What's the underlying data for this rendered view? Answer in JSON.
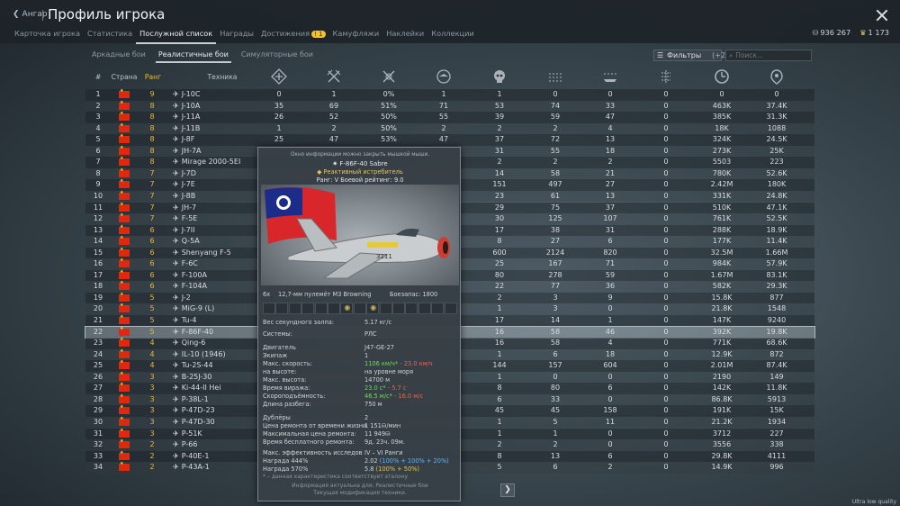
{
  "header": {
    "back_label": "Ангар",
    "title": "Профиль игрока",
    "tabs": [
      {
        "label": "Карточка игрока"
      },
      {
        "label": "Статистика"
      },
      {
        "label": "Послужной список"
      },
      {
        "label": "Награды"
      },
      {
        "label": "Достижения"
      },
      {
        "label": "Камуфляжи"
      },
      {
        "label": "Наклейки"
      },
      {
        "label": "Коллекции"
      }
    ],
    "achievements_badge": "! 1",
    "silver": "936 267",
    "gold": "1 173"
  },
  "subtabs": [
    {
      "label": "Аркадные бои"
    },
    {
      "label": "Реалистичные бои"
    },
    {
      "label": "Симуляторные бои"
    }
  ],
  "filter": {
    "label": "Фильтры",
    "count": "(+2)"
  },
  "search": {
    "placeholder": "Поиск..."
  },
  "columns": {
    "num": "#",
    "country": "Страна",
    "rank": "Ранг",
    "vehicle": "Техника"
  },
  "column_icons": [
    "victories-icon",
    "kills-icon",
    "win-rate-icon",
    "air-kills-icon",
    "deaths-icon",
    "ground-kills-icon",
    "naval-kills-icon",
    "flights-icon",
    "time-icon",
    "score-icon"
  ],
  "rows": [
    {
      "n": "1",
      "rank": "9",
      "name": "J-10C",
      "v": [
        "0",
        "1",
        "0%",
        "1",
        "1",
        "0",
        "0",
        "0",
        "0",
        "0"
      ]
    },
    {
      "n": "2",
      "rank": "8",
      "name": "J-10A",
      "v": [
        "35",
        "69",
        "51%",
        "71",
        "53",
        "74",
        "33",
        "0",
        "463K",
        "37.4K"
      ]
    },
    {
      "n": "3",
      "rank": "8",
      "name": "J-11A",
      "v": [
        "26",
        "52",
        "50%",
        "55",
        "39",
        "59",
        "47",
        "0",
        "385K",
        "31.3K"
      ]
    },
    {
      "n": "4",
      "rank": "8",
      "name": "J-11B",
      "v": [
        "1",
        "2",
        "50%",
        "2",
        "2",
        "2",
        "4",
        "0",
        "18K",
        "1088"
      ]
    },
    {
      "n": "5",
      "rank": "8",
      "name": "J-8F",
      "v": [
        "25",
        "47",
        "53%",
        "47",
        "37",
        "72",
        "13",
        "0",
        "324K",
        "24.5K"
      ]
    },
    {
      "n": "6",
      "rank": "8",
      "name": "JH-7A",
      "v": [
        "",
        "",
        "",
        "",
        "31",
        "55",
        "18",
        "0",
        "273K",
        "25K"
      ]
    },
    {
      "n": "7",
      "rank": "8",
      "name": "Mirage 2000-5EI",
      "v": [
        "",
        "",
        "",
        "",
        "2",
        "2",
        "2",
        "0",
        "5503",
        "223"
      ]
    },
    {
      "n": "8",
      "rank": "7",
      "name": "J-7D",
      "v": [
        "",
        "",
        "",
        "",
        "14",
        "58",
        "21",
        "0",
        "780K",
        "52.6K"
      ]
    },
    {
      "n": "9",
      "rank": "7",
      "name": "J-7E",
      "v": [
        "",
        "",
        "",
        "",
        "151",
        "497",
        "27",
        "0",
        "2.42M",
        "180K"
      ]
    },
    {
      "n": "10",
      "rank": "7",
      "name": "J-8B",
      "v": [
        "",
        "",
        "",
        "",
        "23",
        "61",
        "13",
        "0",
        "331K",
        "24.8K"
      ]
    },
    {
      "n": "11",
      "rank": "7",
      "name": "JH-7",
      "v": [
        "",
        "",
        "",
        "",
        "29",
        "75",
        "37",
        "0",
        "510K",
        "47.1K"
      ]
    },
    {
      "n": "12",
      "rank": "7",
      "name": "F-5E",
      "v": [
        "",
        "",
        "",
        "",
        "30",
        "125",
        "107",
        "0",
        "761K",
        "52.5K"
      ]
    },
    {
      "n": "13",
      "rank": "6",
      "name": "J-7II",
      "v": [
        "",
        "",
        "",
        "",
        "17",
        "38",
        "31",
        "0",
        "288K",
        "18.9K"
      ]
    },
    {
      "n": "14",
      "rank": "6",
      "name": "Q-5A",
      "v": [
        "",
        "",
        "",
        "",
        "8",
        "27",
        "6",
        "0",
        "177K",
        "11.4K"
      ]
    },
    {
      "n": "15",
      "rank": "6",
      "name": "Shenyang F-5",
      "v": [
        "",
        "",
        "",
        "",
        "600",
        "2124",
        "820",
        "0",
        "32.5M",
        "1.66M"
      ]
    },
    {
      "n": "16",
      "rank": "6",
      "name": "F-6C",
      "v": [
        "",
        "",
        "",
        "",
        "25",
        "167",
        "71",
        "0",
        "984K",
        "57.9K"
      ]
    },
    {
      "n": "17",
      "rank": "6",
      "name": "F-100A",
      "v": [
        "",
        "",
        "",
        "",
        "80",
        "278",
        "59",
        "0",
        "1.67M",
        "83.1K"
      ]
    },
    {
      "n": "18",
      "rank": "6",
      "name": "F-104A",
      "v": [
        "",
        "",
        "",
        "",
        "22",
        "77",
        "36",
        "0",
        "582K",
        "29.3K"
      ]
    },
    {
      "n": "19",
      "rank": "5",
      "name": "J-2",
      "v": [
        "",
        "",
        "",
        "",
        "2",
        "3",
        "9",
        "0",
        "15.8K",
        "877"
      ]
    },
    {
      "n": "20",
      "rank": "5",
      "name": "MiG-9 (L)",
      "v": [
        "",
        "",
        "",
        "",
        "1",
        "3",
        "0",
        "0",
        "21.8K",
        "1548"
      ]
    },
    {
      "n": "21",
      "rank": "5",
      "name": "Tu-4",
      "v": [
        "",
        "",
        "",
        "",
        "17",
        "14",
        "1",
        "0",
        "147K",
        "9240"
      ]
    },
    {
      "n": "22",
      "rank": "5",
      "name": "F-86F-40",
      "v": [
        "",
        "",
        "",
        "",
        "16",
        "58",
        "46",
        "0",
        "392K",
        "19.8K"
      ]
    },
    {
      "n": "23",
      "rank": "4",
      "name": "Qing-6",
      "v": [
        "",
        "",
        "",
        "",
        "16",
        "58",
        "4",
        "0",
        "771K",
        "68.6K"
      ]
    },
    {
      "n": "24",
      "rank": "4",
      "name": "IL-10 (1946)",
      "v": [
        "",
        "",
        "",
        "",
        "1",
        "6",
        "18",
        "0",
        "12.9K",
        "872"
      ]
    },
    {
      "n": "25",
      "rank": "4",
      "name": "Tu-2S-44",
      "v": [
        "",
        "",
        "",
        "",
        "144",
        "157",
        "604",
        "0",
        "2.01M",
        "87.4K"
      ]
    },
    {
      "n": "26",
      "rank": "3",
      "name": "B-25J-30",
      "v": [
        "",
        "",
        "",
        "",
        "1",
        "0",
        "0",
        "0",
        "2190",
        "149"
      ]
    },
    {
      "n": "27",
      "rank": "3",
      "name": "Ki-44-II Hei",
      "v": [
        "",
        "",
        "",
        "",
        "8",
        "80",
        "6",
        "0",
        "142K",
        "11.8K"
      ]
    },
    {
      "n": "28",
      "rank": "3",
      "name": "P-38L-1",
      "v": [
        "",
        "",
        "",
        "",
        "6",
        "33",
        "0",
        "0",
        "86.8K",
        "5913"
      ]
    },
    {
      "n": "29",
      "rank": "3",
      "name": "P-47D-23",
      "v": [
        "",
        "",
        "",
        "",
        "45",
        "45",
        "158",
        "0",
        "191K",
        "15K"
      ]
    },
    {
      "n": "30",
      "rank": "3",
      "name": "P-47D-30",
      "v": [
        "",
        "",
        "",
        "",
        "1",
        "5",
        "11",
        "0",
        "21.2K",
        "1934"
      ]
    },
    {
      "n": "31",
      "rank": "3",
      "name": "P-51K",
      "v": [
        "",
        "",
        "",
        "",
        "1",
        "1",
        "0",
        "0",
        "3712",
        "227"
      ]
    },
    {
      "n": "32",
      "rank": "2",
      "name": "P-66",
      "v": [
        "",
        "",
        "",
        "",
        "2",
        "2",
        "0",
        "0",
        "3556",
        "338"
      ]
    },
    {
      "n": "33",
      "rank": "2",
      "name": "P-40E-1",
      "v": [
        "",
        "",
        "",
        "",
        "8",
        "13",
        "6",
        "0",
        "29.8K",
        "4111"
      ]
    },
    {
      "n": "34",
      "rank": "2",
      "name": "P-43A-1",
      "v": [
        "",
        "",
        "",
        "",
        "5",
        "6",
        "2",
        "0",
        "14.9K",
        "996"
      ]
    }
  ],
  "tooltip": {
    "hint": "Окно информации можно закрыть мышкой мыши.",
    "name": "F-86F-40 Sabre",
    "class": "Реактивный истребитель",
    "rank_line": "Ранг: V  Боевой рейтинг: 9.0",
    "weapon_count": "6x",
    "weapon": "12,7-мм пулемёт M3 Browning",
    "ammo": "Боезапас: 1800",
    "salvo_label": "Вес секундного залпа:",
    "salvo_value": "5.17 кг/с",
    "systems_label": "Системы:",
    "systems_value": "РЛС",
    "engine_label": "Двигатель",
    "engine_value": "J47-GE-27",
    "crew_label": "Экипаж",
    "crew_value": "1",
    "speed_label": "Макс. скорость:",
    "speed_value": "1106 км/ч*",
    "speed_delta": "- 23.0 км/ч",
    "alt_label": "на высоте:",
    "alt_value": "на уровне моря",
    "maxalt_label": "Макс. высота:",
    "maxalt_value": "14700 м",
    "turn_label": "Время виража:",
    "turn_value": "23.0 с*",
    "turn_delta": "- 5.7 с",
    "climb_label": "Скороподъёмность:",
    "climb_value": "46.5 м/с*",
    "climb_delta": "- 16.0 м/с",
    "runway_label": "Длина разбега:",
    "runway_value": "750 м",
    "backups_label": "Дублёры",
    "backups_value": "2",
    "repair_label": "Цена ремонта от времени жизни",
    "repair_value": "1 151",
    "repair_unit": "/мин",
    "maxrepair_label": "Максимальная цена ремонта:",
    "maxrepair_value": "11 949",
    "freerepair_label": "Время бесплатного ремонта:",
    "freerepair_value": "9д. 23ч. 09м.",
    "research_label": "Макс. эффективность исследов",
    "research_value": "IV – VI Ранги",
    "reward1_label": "Награда 444%",
    "reward1_value": "2.02",
    "reward1_extra": "(100% + 100% + 20%)",
    "reward2_label": "Награда 570%",
    "reward2_value": "5.8",
    "reward2_extra": "(100% + 50%)",
    "footnote": "* – данная характеристика соответствует эталону",
    "info1": "Информация актуальна для: Реалистичные бои",
    "info2": "Текущая модификация техники."
  },
  "quality_label": "Ultra low quality",
  "colors": {
    "rank": "#f2b838",
    "flag": "#de2910",
    "positive": "#6fdc52",
    "negative": "#ff5a4c"
  }
}
